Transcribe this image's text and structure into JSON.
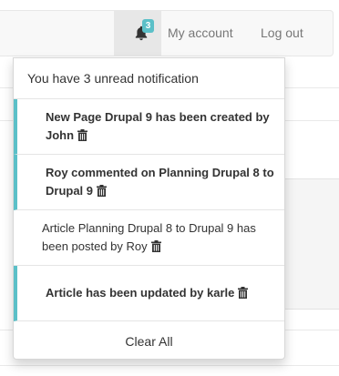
{
  "navbar": {
    "notification_count": "3",
    "bell_icon": "bell-icon",
    "my_account_label": "My account",
    "logout_label": "Log out"
  },
  "notifications": {
    "header": "You have 3 unread notification",
    "items": [
      {
        "text": "New Page Drupal 9 has been created by John",
        "unread": true,
        "icon": "trash-icon"
      },
      {
        "text": "Roy commented on Planning Drupal 8 to Drupal 9",
        "unread": true,
        "icon": "trash-icon"
      },
      {
        "text": "Article Planning Drupal 8 to Drupal 9 has been posted by Roy",
        "unread": false,
        "icon": "trash-icon"
      },
      {
        "text": "Article has been updated by karle",
        "unread": true,
        "icon": "trash-icon"
      }
    ],
    "clear_all_label": "Clear All"
  },
  "colors": {
    "accent": "#5bc0c8",
    "navbar_bg": "#f8f8f8",
    "active_nav_bg": "#e7e7e7",
    "text": "#333333",
    "nav_text": "#777777"
  }
}
